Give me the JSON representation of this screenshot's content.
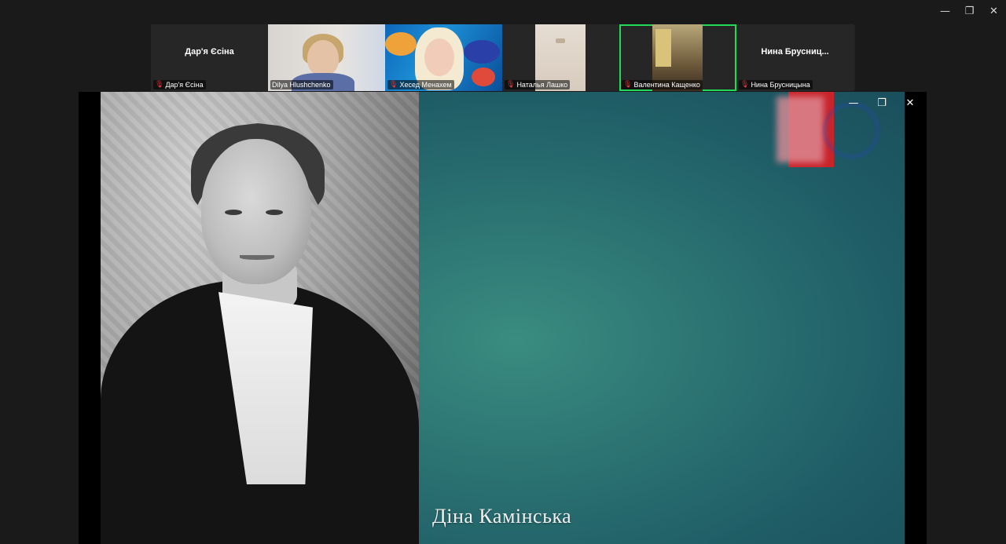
{
  "window_controls": {
    "minimize": "—",
    "restore": "❐",
    "close": "✕"
  },
  "participants": [
    {
      "name": "Дар'я Єсіна",
      "center_name": "Дар'я Єсіна",
      "video": false,
      "muted": true
    },
    {
      "name": "Dilya Hlushchenko",
      "video": true,
      "muted": false
    },
    {
      "name": "Хесед Менахем",
      "video": true,
      "muted": true
    },
    {
      "name": "Наталья Лашко",
      "video": true,
      "muted": true
    },
    {
      "name": "Валентина Кащенко",
      "video": true,
      "muted": true,
      "active_speaker": true,
      "active_color": "#23d959"
    },
    {
      "name": "Нина Брусницына",
      "center_name": "Нина Брусниц...",
      "video": false,
      "muted": true
    }
  ],
  "icons": {
    "mute": "muted-mic-icon"
  },
  "shared_screen": {
    "caption": "Діна Камінська",
    "controls": {
      "minimize": "—",
      "restore": "❐",
      "close": "✕"
    },
    "colors": {
      "teal": "#2c7473",
      "red_bar": "#c9242a"
    }
  }
}
